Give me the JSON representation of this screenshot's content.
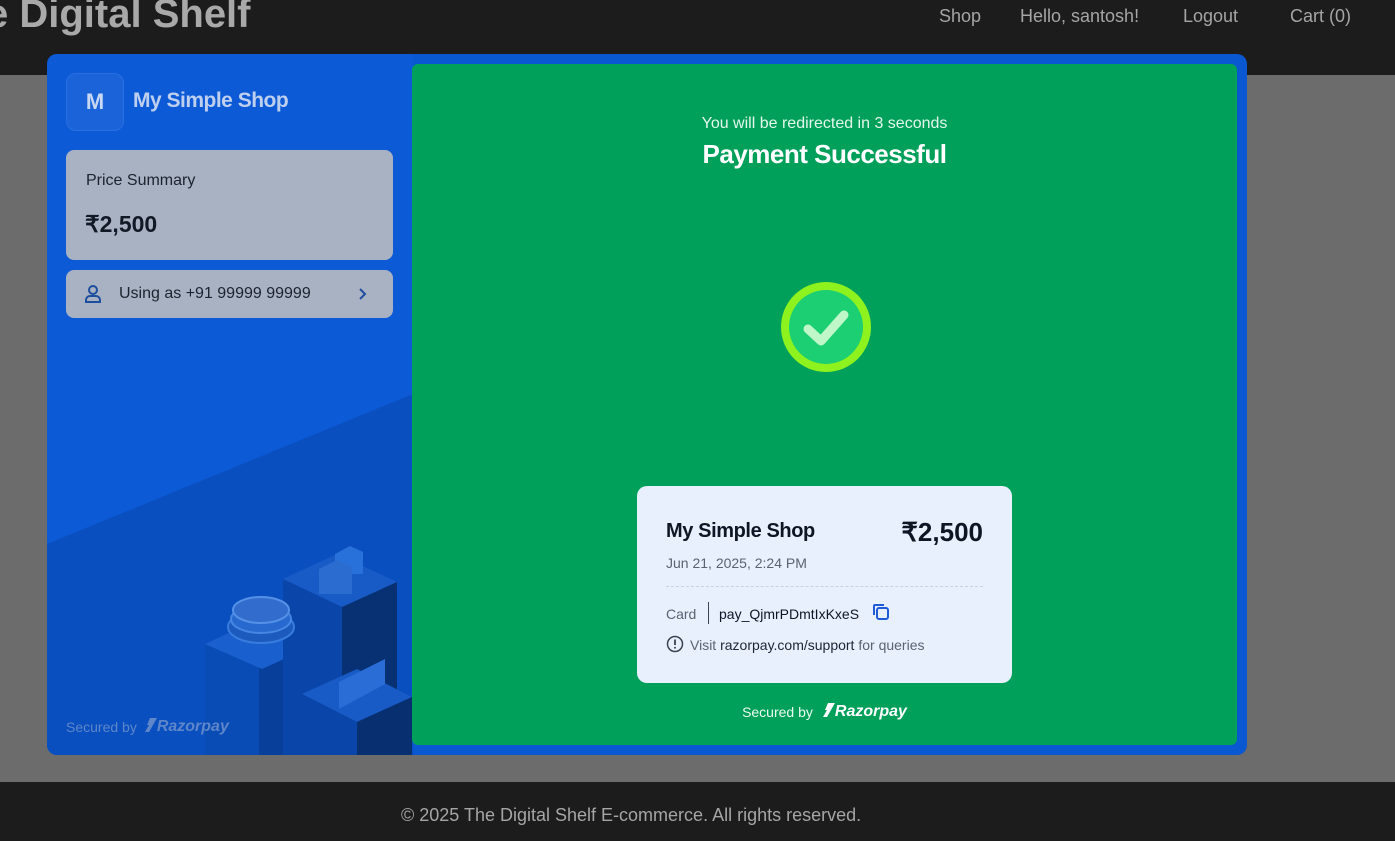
{
  "site": {
    "title": "e Digital Shelf",
    "nav": {
      "shop": "Shop",
      "greeting": "Hello, santosh!",
      "logout": "Logout",
      "cart": "Cart (0)"
    },
    "footer": "© 2025 The Digital Shelf E-commerce. All rights reserved."
  },
  "checkout": {
    "merchant_initial": "M",
    "merchant_name": "My Simple Shop",
    "price_summary_label": "Price Summary",
    "price_summary_value": "₹2,500",
    "using_as": "Using as +91 99999 99999",
    "secured_by": "Secured by",
    "brand": "Razorpay",
    "icons": {
      "user": "user-icon",
      "chevron": "chevron-right-icon",
      "check": "check-circle-icon",
      "copy": "copy-icon",
      "info": "info-icon"
    },
    "colors": {
      "modal_blue": "#0a57d2",
      "success_green": "#00a05a",
      "check_ring": "#8ef21e",
      "receipt_bg": "#e8f0fe"
    }
  },
  "success": {
    "redirect_text": "You will be redirected in 3 seconds",
    "title": "Payment Successful",
    "receipt": {
      "merchant": "My Simple Shop",
      "amount": "₹2,500",
      "datetime": "Jun 21, 2025, 2:24 PM",
      "method": "Card",
      "payment_id": "pay_QjmrPDmtIxKxeS",
      "support_prefix": "Visit",
      "support_link": "razorpay.com/support",
      "support_suffix": "for queries"
    },
    "secured_by": "Secured by",
    "brand": "Razorpay"
  }
}
